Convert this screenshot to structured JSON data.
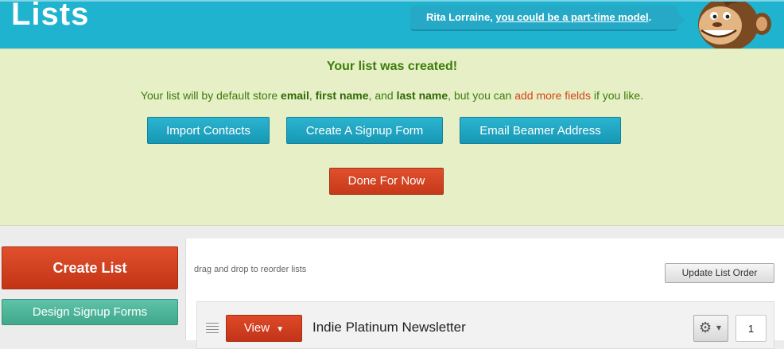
{
  "header": {
    "title": "Lists",
    "bubble": {
      "name": "Rita Lorraine",
      "link_text": "you could be a part-time model",
      "end": "."
    }
  },
  "notice": {
    "title": "Your list was created!",
    "text": {
      "part1": "Your list will by default store ",
      "field1": "email",
      "sep1": ", ",
      "field2": "first name",
      "sep2": ", and ",
      "field3": "last name",
      "part2": ", but you can ",
      "link": "add more fields",
      "part3": " if you like."
    },
    "buttons": {
      "import": "Import Contacts",
      "signup": "Create A Signup Form",
      "beamer": "Email Beamer Address",
      "done": "Done For Now"
    }
  },
  "sidebar": {
    "create_list": "Create List",
    "design_forms": "Design Signup Forms"
  },
  "main": {
    "drag_hint": "drag and drop to reorder lists",
    "update_order": "Update List Order",
    "lists": [
      {
        "view_label": "View",
        "dropdown_icon": "▼",
        "name": "Indie Platinum Newsletter",
        "gear_icon": "⚙",
        "caret_icon": "▾",
        "count": "1"
      }
    ]
  },
  "colors": {
    "header": "#1fb3d0",
    "notice_bg": "#e6efc6",
    "notice_text": "#3c7d0a",
    "primary_red": "#d8431f",
    "button_blue": "#1fa7c4",
    "button_teal": "#4fb59a"
  }
}
